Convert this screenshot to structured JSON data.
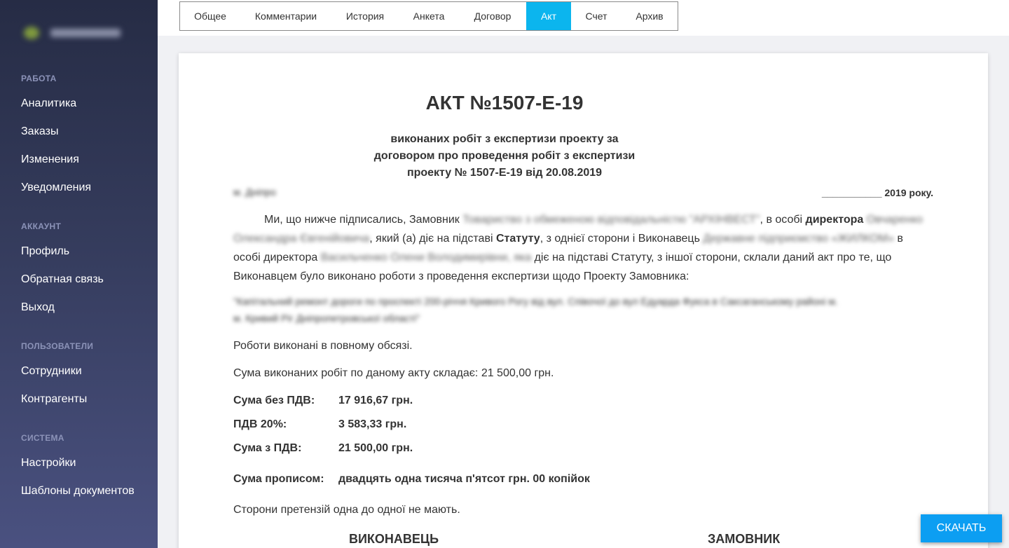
{
  "sidebar": {
    "sections": [
      {
        "title": "РАБОТА",
        "items": [
          "Аналитика",
          "Заказы",
          "Изменения",
          "Уведомления"
        ]
      },
      {
        "title": "АККАУНТ",
        "items": [
          "Профиль",
          "Обратная связь",
          "Выход"
        ]
      },
      {
        "title": "ПОЛЬЗОВАТЕЛИ",
        "items": [
          "Сотрудники",
          "Контрагенты"
        ]
      },
      {
        "title": "СИСТЕМА",
        "items": [
          "Настройки",
          "Шаблоны документов"
        ]
      }
    ]
  },
  "tabs": [
    {
      "label": "Общее",
      "active": false
    },
    {
      "label": "Комментарии",
      "active": false
    },
    {
      "label": "История",
      "active": false
    },
    {
      "label": "Анкета",
      "active": false
    },
    {
      "label": "Договор",
      "active": false
    },
    {
      "label": "Акт",
      "active": true
    },
    {
      "label": "Счет",
      "active": false
    },
    {
      "label": "Архив",
      "active": false
    }
  ],
  "document": {
    "title": "АКТ №1507-Е-19",
    "subtitle_lines": [
      "виконаних робіт з експертизи проекту за",
      "договором про проведення робіт з експертизи",
      "проекту № 1507-Е-19 від 20.08.2019"
    ],
    "city": "м. Дніпро",
    "date": "___________ 2019 року.",
    "intro": {
      "p1": "Ми, що нижче підписались, Замовник",
      "customer": "Товариство з обмеженою відповідальністю \"АРХІНВЕСТ\"",
      "p2": ", в особі",
      "p3": "директора",
      "customer_rep": "Овчаренко Олександра Євгенійовича",
      "p4": ", який (а) діє на підставі",
      "p5": "Статуту",
      "p6": ", з однієї сторони і Виконавець",
      "contractor": "Державне підприємство «ЖИЛКОМ»",
      "p7": " в особі директора",
      "contractor_rep": "Васильченко Олени Володимирівни, яка",
      "p8": " діє на підставі Статуту, з іншої сторони, склали даний акт про те, що Виконавцем було виконано роботи з проведення експертизи щодо Проекту Замовника:"
    },
    "project": "\"Капітальний ремонт дороги по проспекті 200-річчя Кривого Рогу від вул. Співочої до вул Едуарда Фукса в Саксаганському районі м. м. Кривий Ріг Дніпропетровської області\"",
    "completed": "Роботи виконані в повному обсязі.",
    "sum_line": "Сума виконаних робіт по даному акту складає: 21 500,00 грн.",
    "amounts": [
      {
        "label": "Сума без ПДВ:",
        "value": "17 916,67 грн."
      },
      {
        "label": "ПДВ 20%:",
        "value": "3 583,33 грн."
      },
      {
        "label": "Сума з ПДВ:",
        "value": "21 500,00 грн."
      }
    ],
    "in_words_label": "Сума прописом:",
    "in_words_value": "двадцять одна тисяча п'ятсот грн. 00 копійок",
    "no_claims": "Сторони претензій одна до одної не мають.",
    "contractor_heading": "ВИКОНАВЕЦЬ",
    "customer_heading": "ЗАМОВНИК"
  },
  "download_label": "СКАЧАТЬ"
}
